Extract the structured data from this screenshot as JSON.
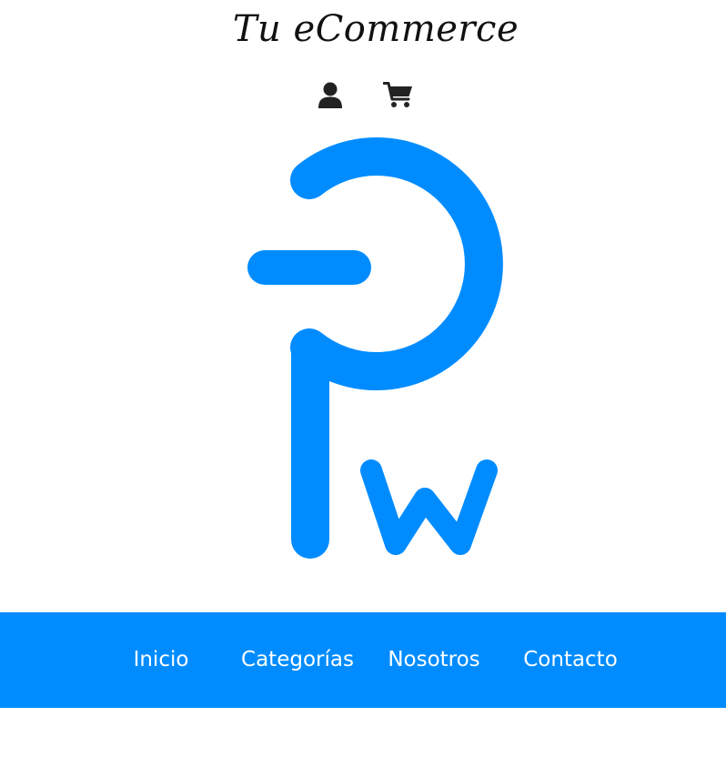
{
  "header": {
    "title": "Tu eCommerce",
    "icons": {
      "account": "user-icon",
      "cart": "cart-icon"
    }
  },
  "logo": {
    "name": "pw-logo",
    "color": "#008cff"
  },
  "nav": {
    "background": "#008cff",
    "items": [
      {
        "label": "Inicio"
      },
      {
        "label": "Categorías"
      },
      {
        "label": "Nosotros"
      },
      {
        "label": "Contacto"
      }
    ]
  }
}
